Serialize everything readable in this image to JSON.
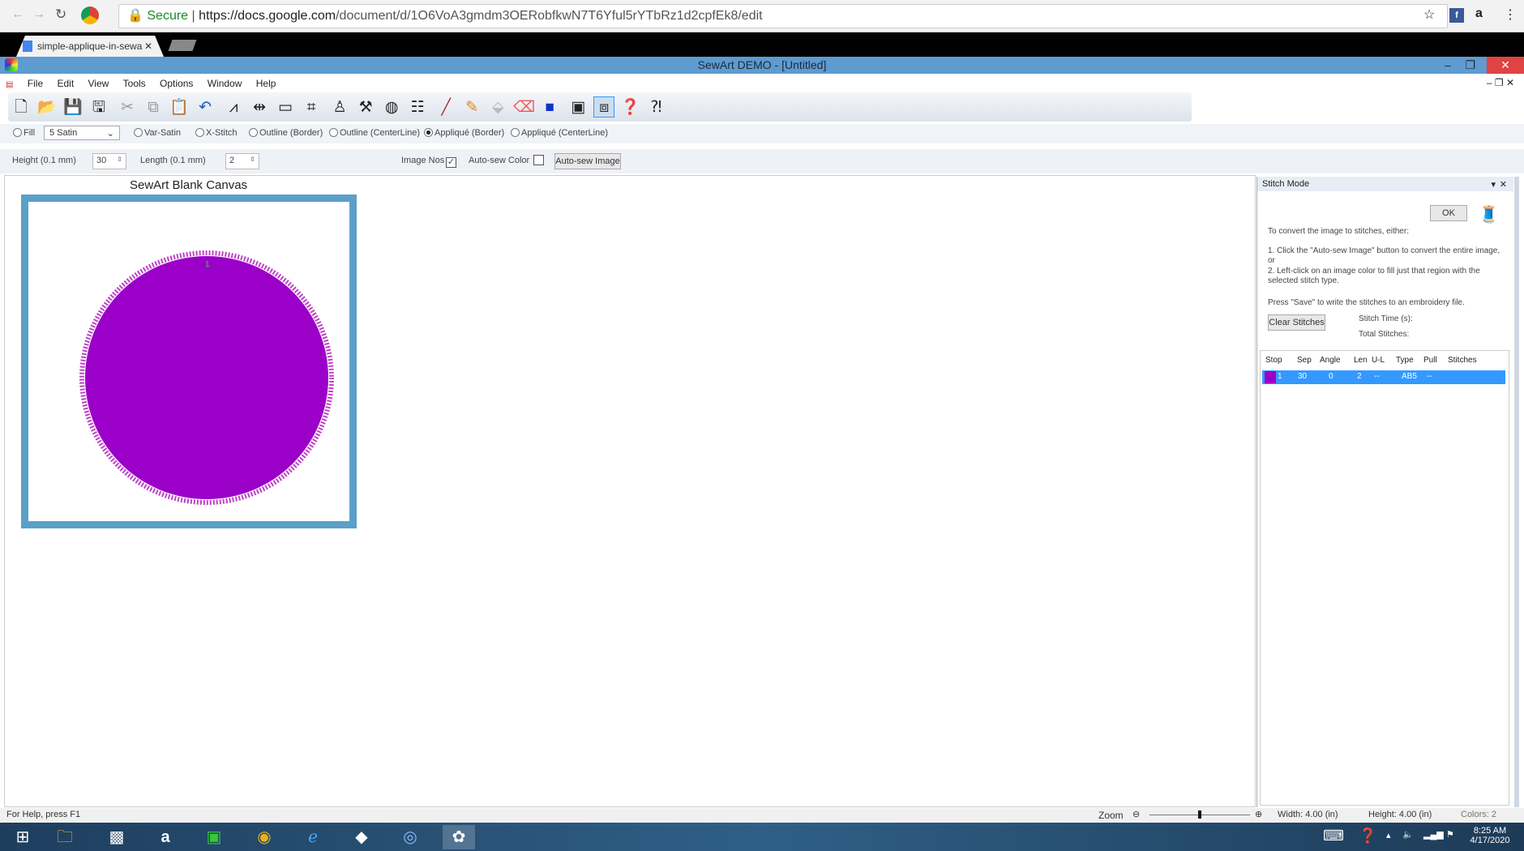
{
  "browser": {
    "secure_label": "Secure",
    "url_host": "https://docs.google.com",
    "url_path": "/document/d/1O6VoA3gmdm3OERobfkwN7T6Yful5rYTbRz1d2cpfEk8/edit",
    "tab_title": "simple-applique-in-sewa"
  },
  "app": {
    "title": "SewArt DEMO - [Untitled]"
  },
  "menu": [
    "File",
    "Edit",
    "View",
    "Tools",
    "Options",
    "Window",
    "Help"
  ],
  "stitch_options": {
    "fill": "Fill",
    "fill_type": "5 Satin",
    "var_satin": "Var-Satin",
    "x_stitch": "X-Stitch",
    "outline_border": "Outline (Border)",
    "outline_centerline": "Outline (CenterLine)",
    "applique_border": "Appliqué (Border)",
    "applique_centerline": "Appliqué (CenterLine)",
    "selected": "applique_border"
  },
  "params": {
    "height_label": "Height (0.1 mm)",
    "height_value": "30",
    "length_label": "Length (0.1 mm)",
    "length_value": "2",
    "image_nos_label": "Image Nos",
    "image_nos_checked": true,
    "auto_sew_color_label": "Auto-sew Color",
    "auto_sew_color_checked": false,
    "auto_sew_image_button": "Auto-sew Image"
  },
  "canvas": {
    "title": "SewArt Blank Canvas",
    "frame_color": "#5ba0c8",
    "shape_color": "#9b00c8",
    "region_number": "1"
  },
  "stitch_panel": {
    "title": "Stitch Mode",
    "ok": "OK",
    "intro": "To convert the image to stitches, either:",
    "step1": "1. Click the \"Auto-sew Image\" button to convert the entire image, or",
    "step2": "2. Left-click on an image color to fill just that region with the selected stitch type.",
    "save_note": "Press \"Save\" to write the stitches to an embroidery file.",
    "clear_button": "Clear Stitches",
    "stitch_time_label": "Stitch Time (s):",
    "total_stitches_label": "Total Stitches:",
    "columns": [
      "Stop",
      "Sep",
      "Angle",
      "Len",
      "U-L",
      "Type",
      "Pull",
      "Stitches"
    ],
    "rows": [
      {
        "color": "#9b00c8",
        "stop": "1",
        "sep": "30",
        "angle": "0",
        "len": "2",
        "ul": "--",
        "type": "AB5",
        "pull": "--",
        "stitches": ""
      }
    ]
  },
  "status": {
    "help": "For Help, press F1",
    "zoom_label": "Zoom",
    "zoom_level": 0.5,
    "width": "Width: 4.00 (in)",
    "height": "Height: 4.00 (in)",
    "colors": "Colors: 2"
  },
  "taskbar": {
    "time": "8:25 AM",
    "date": "4/17/2020"
  }
}
